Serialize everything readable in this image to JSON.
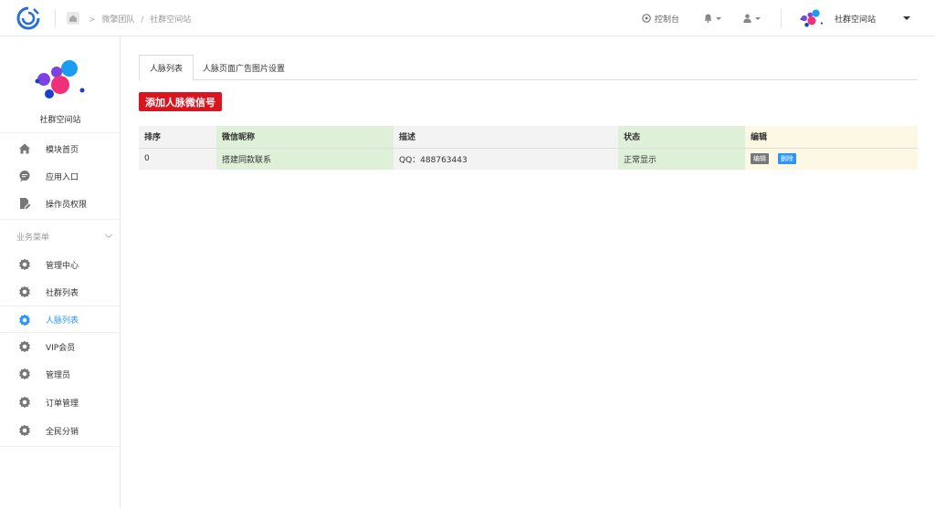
{
  "topbar": {
    "breadcrumb": {
      "team": "微擎团队",
      "separator": "/",
      "site": "社群空间站"
    },
    "console_label": "控制台",
    "site_name": "社群空间站"
  },
  "sidebar": {
    "brand_name": "社群空间站",
    "main_items": [
      {
        "label": "模块首页",
        "icon": "home-icon"
      },
      {
        "label": "应用入口",
        "icon": "chat-icon"
      },
      {
        "label": "操作员权限",
        "icon": "document-edit-icon"
      }
    ],
    "section_label": "业务菜单",
    "business_items": [
      {
        "label": "管理中心",
        "icon": "gear-icon"
      },
      {
        "label": "社群列表",
        "icon": "gear-icon"
      },
      {
        "label": "人脉列表",
        "icon": "gear-icon",
        "active": true
      },
      {
        "label": "VIP会员",
        "icon": "gear-icon"
      },
      {
        "label": "管理员",
        "icon": "gear-icon"
      },
      {
        "label": "订单管理",
        "icon": "gear-icon"
      },
      {
        "label": "全民分销",
        "icon": "gear-icon"
      }
    ]
  },
  "main": {
    "tabs": [
      {
        "label": "人脉列表",
        "active": true
      },
      {
        "label": "人脉页面广告图片设置",
        "active": false
      }
    ],
    "add_button": "添加人脉微信号",
    "table": {
      "headers": [
        "排序",
        "微信昵称",
        "描述",
        "状态",
        "编辑"
      ],
      "rows": [
        {
          "order": "0",
          "nickname": "搭建同款联系",
          "description": "QQ：488763443",
          "status": "正常显示",
          "edit_label": "编辑",
          "delete_label": "删除"
        }
      ]
    }
  },
  "colors": {
    "accent": "#2b95ff",
    "add_button": "#d9161f",
    "green_col": "#dff0d8",
    "yellow_col": "#fcf8e3"
  }
}
